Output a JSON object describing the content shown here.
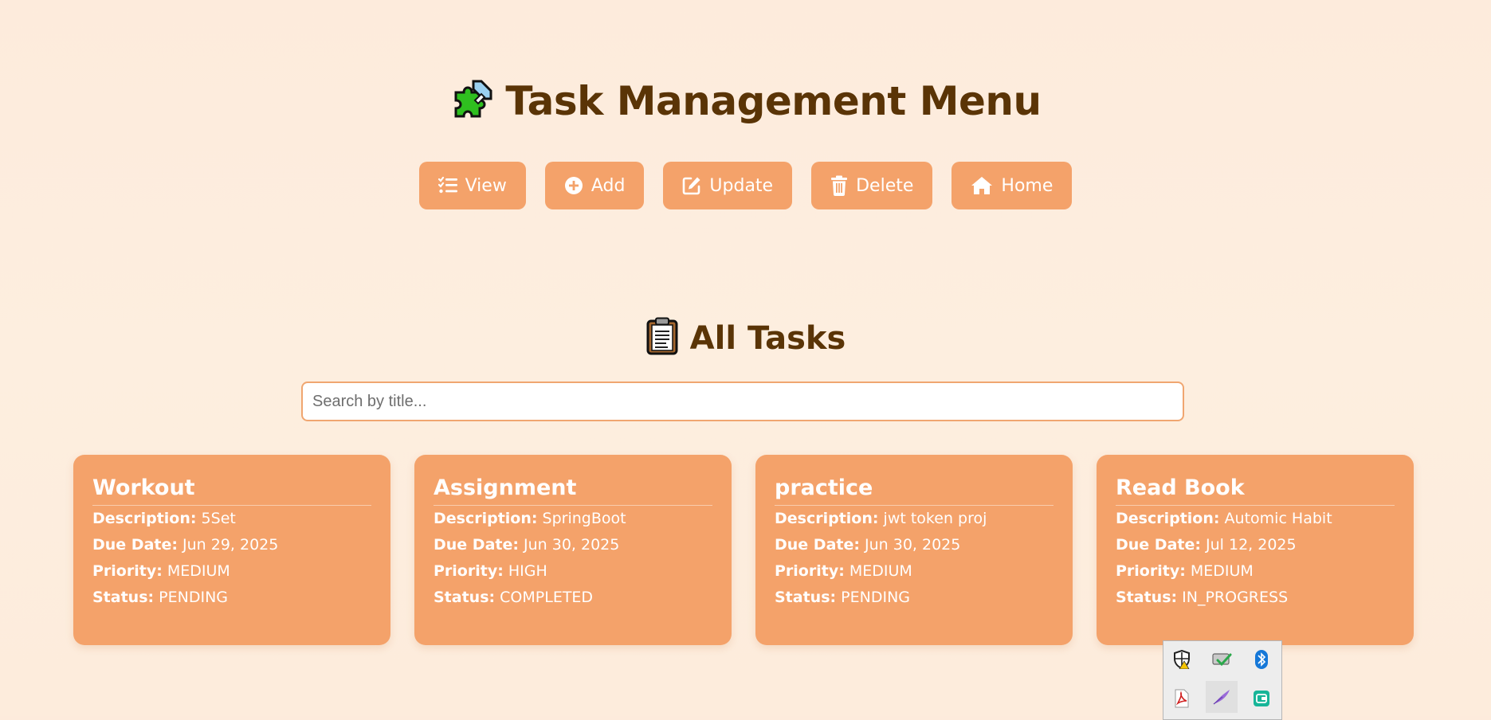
{
  "header": {
    "title": "Task Management Menu",
    "title_icon": "puzzle-piece-icon"
  },
  "nav": [
    {
      "label": "View",
      "icon": "list-check-icon"
    },
    {
      "label": "Add",
      "icon": "plus-circle-icon"
    },
    {
      "label": "Update",
      "icon": "edit-icon"
    },
    {
      "label": "Delete",
      "icon": "trash-icon"
    },
    {
      "label": "Home",
      "icon": "home-icon"
    }
  ],
  "tasks_section": {
    "title": "All Tasks",
    "title_icon": "clipboard-icon"
  },
  "search": {
    "placeholder": "Search by title...",
    "value": ""
  },
  "field_labels": {
    "description": "Description:",
    "due_date": "Due Date:",
    "priority": "Priority:",
    "status": "Status:"
  },
  "tasks": [
    {
      "title": "Workout",
      "description": "5Set",
      "due_date": "Jun 29, 2025",
      "priority": "MEDIUM",
      "status": "PENDING"
    },
    {
      "title": "Assignment",
      "description": "SpringBoot",
      "due_date": "Jun 30, 2025",
      "priority": "HIGH",
      "status": "COMPLETED"
    },
    {
      "title": "practice",
      "description": "jwt token proj",
      "due_date": "Jun 30, 2025",
      "priority": "MEDIUM",
      "status": "PENDING"
    },
    {
      "title": "Read Book",
      "description": "Automic Habit",
      "due_date": "Jul 12, 2025",
      "priority": "MEDIUM",
      "status": "IN_PROGRESS"
    }
  ],
  "system_tray": {
    "icons": [
      "security-shield-icon",
      "network-check-icon",
      "bluetooth-icon",
      "pdf-icon",
      "pen-feather-icon",
      "wallet-icon"
    ]
  },
  "colors": {
    "background": "#fdebdc",
    "accent": "#f4a26a",
    "title_text": "#5a3406",
    "card_text": "#ffffff"
  }
}
